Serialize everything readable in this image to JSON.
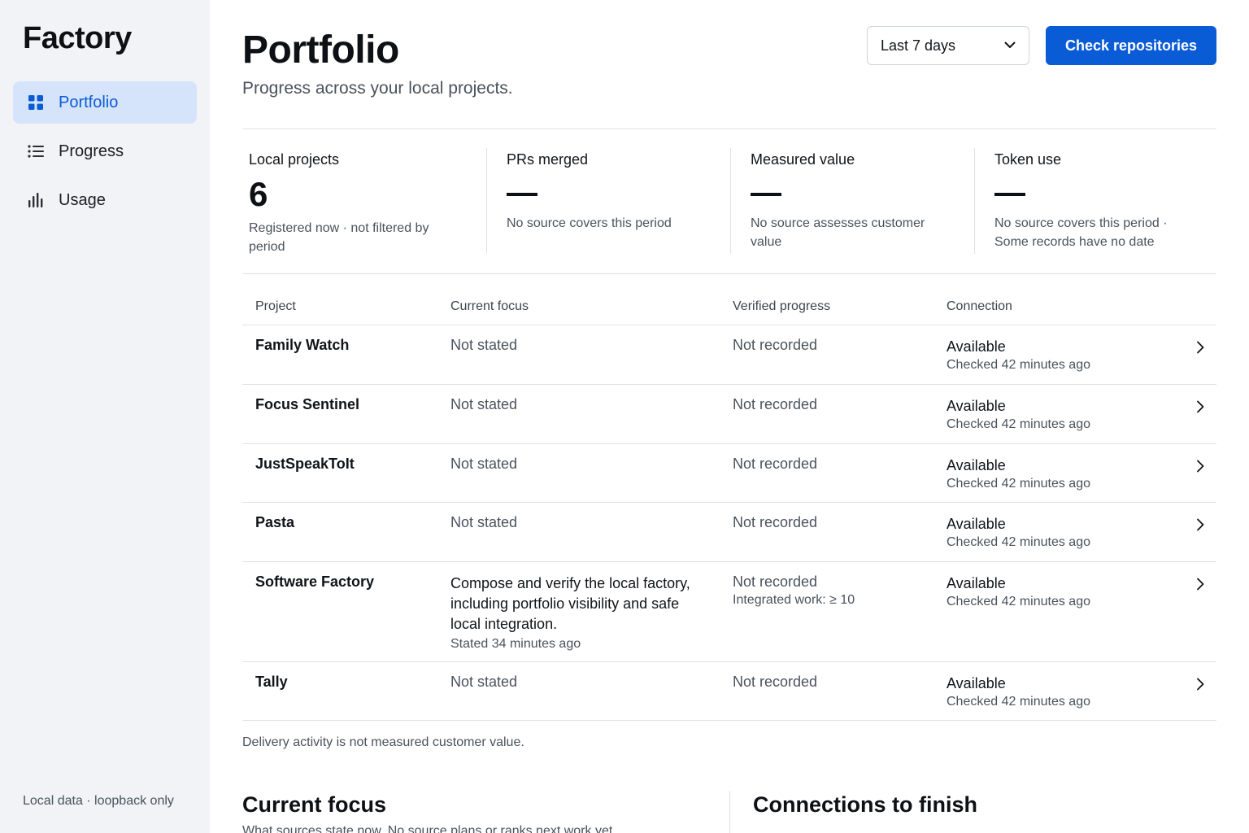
{
  "sidebar": {
    "brand": "Factory",
    "items": [
      {
        "label": "Portfolio",
        "icon": "grid-icon",
        "active": true
      },
      {
        "label": "Progress",
        "icon": "list-icon",
        "active": false
      },
      {
        "label": "Usage",
        "icon": "bar-chart-icon",
        "active": false
      }
    ],
    "footer": "Local data · loopback only"
  },
  "header": {
    "title": "Portfolio",
    "subtitle": "Progress across your local projects.",
    "period_select": "Last 7 days",
    "check_button": "Check repositories"
  },
  "metrics": [
    {
      "label": "Local projects",
      "value": "6",
      "note": "Registered now · not filtered by period"
    },
    {
      "label": "PRs merged",
      "value": "—",
      "note": "No source covers this period"
    },
    {
      "label": "Measured value",
      "value": "—",
      "note": "No source assesses customer value"
    },
    {
      "label": "Token use",
      "value": "—",
      "note": "No source covers this period · Some records have no date"
    }
  ],
  "table": {
    "columns": [
      "Project",
      "Current focus",
      "Verified progress",
      "Connection"
    ],
    "rows": [
      {
        "project": "Family Watch",
        "focus": "Not stated",
        "focus_note": "",
        "progress": "Not recorded",
        "progress_note": "",
        "connection": "Available",
        "checked": "Checked 42 minutes ago"
      },
      {
        "project": "Focus Sentinel",
        "focus": "Not stated",
        "focus_note": "",
        "progress": "Not recorded",
        "progress_note": "",
        "connection": "Available",
        "checked": "Checked 42 minutes ago"
      },
      {
        "project": "JustSpeakToIt",
        "focus": "Not stated",
        "focus_note": "",
        "progress": "Not recorded",
        "progress_note": "",
        "connection": "Available",
        "checked": "Checked 42 minutes ago"
      },
      {
        "project": "Pasta",
        "focus": "Not stated",
        "focus_note": "",
        "progress": "Not recorded",
        "progress_note": "",
        "connection": "Available",
        "checked": "Checked 42 minutes ago"
      },
      {
        "project": "Software Factory",
        "focus": "Compose and verify the local factory, including portfolio visibility and safe local integration.",
        "focus_note": "Stated 34 minutes ago",
        "progress": "Not recorded",
        "progress_note": "Integrated work: ≥ 10",
        "connection": "Available",
        "checked": "Checked 42 minutes ago"
      },
      {
        "project": "Tally",
        "focus": "Not stated",
        "focus_note": "",
        "progress": "Not recorded",
        "progress_note": "",
        "connection": "Available",
        "checked": "Checked 42 minutes ago"
      }
    ],
    "footnote": "Delivery activity is not measured customer value."
  },
  "sections": {
    "current_focus": {
      "title": "Current focus",
      "subtitle": "What sources state now. No source plans or ranks next work yet."
    },
    "connections": {
      "title": "Connections to finish"
    }
  },
  "colors": {
    "accent": "#0a5bd6",
    "sidebar_bg": "#f1f3f7",
    "active_bg": "#d5e4fb"
  }
}
